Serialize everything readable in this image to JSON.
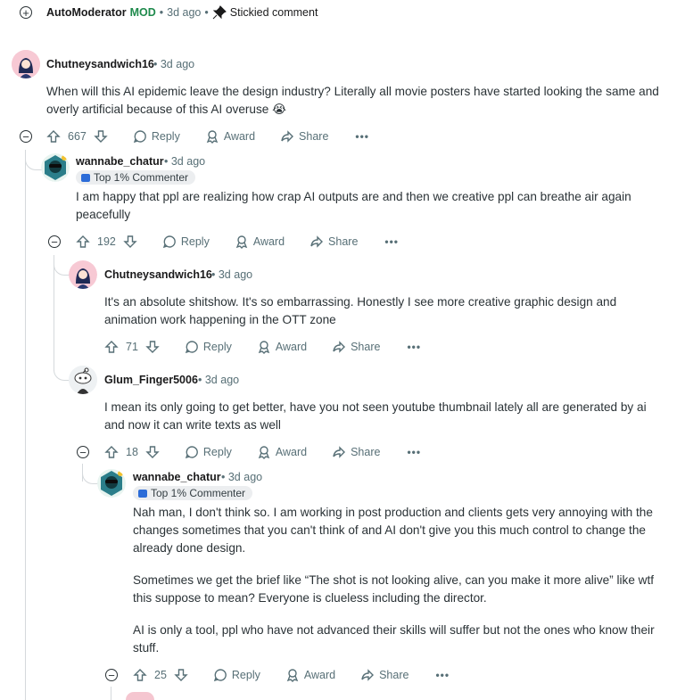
{
  "top": {
    "username": "AutoModerator",
    "mod_label": "MOD",
    "time": "3d ago",
    "stickied": "Stickied comment"
  },
  "comments": [
    {
      "username": "Chutneysandwich16",
      "time": "3d ago",
      "body": [
        "When will this AI epidemic leave the design industry? Literally all movie posters have started looking the same and overly artificial because of this AI overuse 😭"
      ],
      "votes": "667"
    },
    {
      "username": "wannabe_chatur",
      "time": "3d ago",
      "flair": "Top 1% Commenter",
      "body": [
        "I am happy that ppl are realizing how crap AI outputs are and then we creative ppl can breathe air again peacefully"
      ],
      "votes": "192"
    },
    {
      "username": "Chutneysandwich16",
      "time": "3d ago",
      "body": [
        "It's an absolute shitshow. It's so embarrassing. Honestly I see more creative graphic design and animation work happening in the OTT zone"
      ],
      "votes": "71"
    },
    {
      "username": "Glum_Finger5006",
      "time": "3d ago",
      "body": [
        "I mean its only going to get better, have you not seen youtube thumbnail lately all are generated by ai and now it can write texts as well"
      ],
      "votes": "18"
    },
    {
      "username": "wannabe_chatur",
      "time": "3d ago",
      "flair": "Top 1% Commenter",
      "body": [
        "Nah man, I don't think so. I am working in post production and clients gets very annoying with the changes sometimes that you can't think of and AI don't give you this much control to change the already done design.",
        "Sometimes we get the brief like “The shot is not looking alive, can you make it more alive” like wtf this suppose to mean? Everyone is clueless including the director.",
        "AI is only a tool, ppl who have not advanced their skills will suffer but not the ones who know their stuff."
      ],
      "votes": "25"
    }
  ],
  "actions": {
    "reply": "Reply",
    "award": "Award",
    "share": "Share",
    "more": "•••"
  },
  "icons": {
    "expand": "plus-circle-icon",
    "collapse": "minus-circle-icon",
    "pin": "pin-icon",
    "upvote": "upvote-icon",
    "downvote": "downvote-icon",
    "reply": "comment-bubble-icon",
    "award": "award-icon",
    "share": "share-arrow-icon"
  }
}
